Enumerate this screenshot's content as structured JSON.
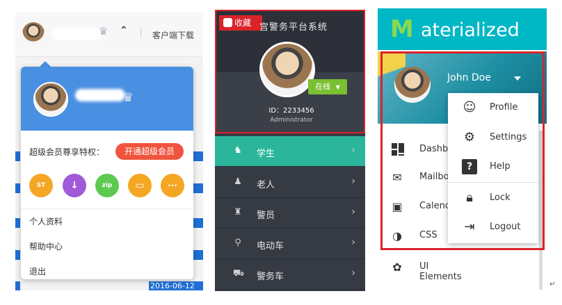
{
  "panel1": {
    "client_download": "客户端下载",
    "vip_privilege": "超级会员尊享特权：",
    "vip_button": "开通超级会员",
    "app_icons": [
      {
        "label": "ST",
        "color": "#f5a623"
      },
      {
        "label": "↓",
        "color": "#a05ad8"
      },
      {
        "label": "zip",
        "color": "#5dc94f"
      },
      {
        "label": "▭",
        "color": "#f5a623"
      },
      {
        "label": "···",
        "color": "#f5a623"
      }
    ],
    "menu": [
      "个人资料",
      "帮助中心",
      "退出"
    ],
    "bg_date": "2016-06-12"
  },
  "panel2": {
    "favorite": "收藏",
    "system_title": "宫警务平台系统",
    "status": "在线",
    "user_id": "ID：2233456",
    "role": "Administrator",
    "nav": [
      {
        "label": "学生",
        "icon": "student-icon",
        "active": true
      },
      {
        "label": "老人",
        "icon": "elder-icon",
        "active": false
      },
      {
        "label": "警员",
        "icon": "police-icon",
        "active": false
      },
      {
        "label": "电动车",
        "icon": "scooter-icon",
        "active": false
      },
      {
        "label": "警务车",
        "icon": "police-car-icon",
        "active": false
      }
    ]
  },
  "panel3": {
    "brand_letter": "M",
    "brand_rest": "aterialized",
    "user_name": "John Doe",
    "sidebar": [
      {
        "label": "Dashbo",
        "icon": "dashboard-icon"
      },
      {
        "label": "Mailbo",
        "icon": "mail-icon"
      },
      {
        "label": "Calend",
        "icon": "calendar-icon"
      },
      {
        "label": "CSS",
        "icon": "css-icon"
      },
      {
        "label": "UI Elements",
        "icon": "palette-icon"
      }
    ],
    "dropdown": [
      {
        "label": "Profile",
        "icon": "face-icon"
      },
      {
        "label": "Settings",
        "icon": "gear-icon"
      },
      {
        "label": "Help",
        "icon": "help-icon"
      },
      {
        "label": "Lock",
        "icon": "lock-icon"
      },
      {
        "label": "Logout",
        "icon": "logout-icon"
      }
    ]
  }
}
